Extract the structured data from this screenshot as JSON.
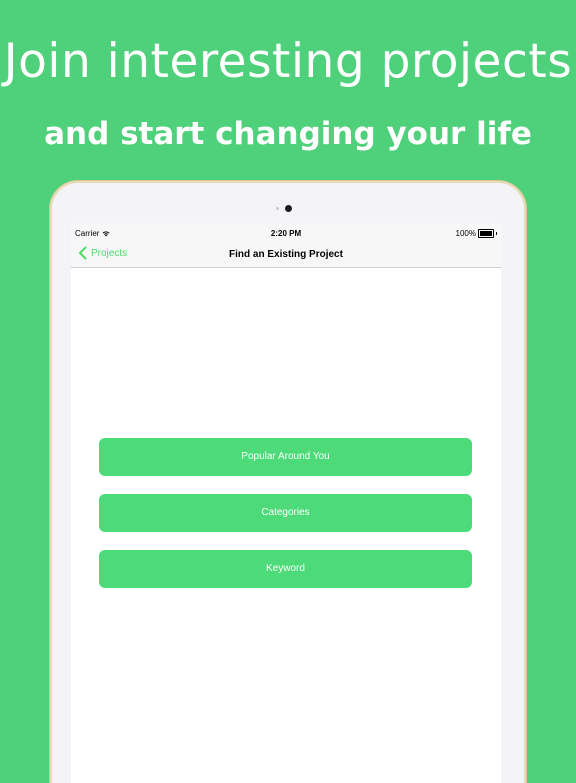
{
  "promo": {
    "headline": "Join interesting projects",
    "subline": "and start changing your life"
  },
  "status_bar": {
    "carrier": "Carrier",
    "time": "2:20 PM",
    "battery": "100%",
    "battery_level": 1.0
  },
  "nav": {
    "back_label": "Projects",
    "title": "Find an Existing Project"
  },
  "options": {
    "popular_label": "Popular Around You",
    "categories_label": "Categories",
    "keyword_label": "Keyword"
  },
  "colors": {
    "background": "#4fd07a",
    "accent": "#4cd964",
    "button": "#4cdb78"
  },
  "icons": {
    "back": "chevron-left-icon",
    "wifi": "wifi-icon",
    "battery": "battery-icon"
  }
}
